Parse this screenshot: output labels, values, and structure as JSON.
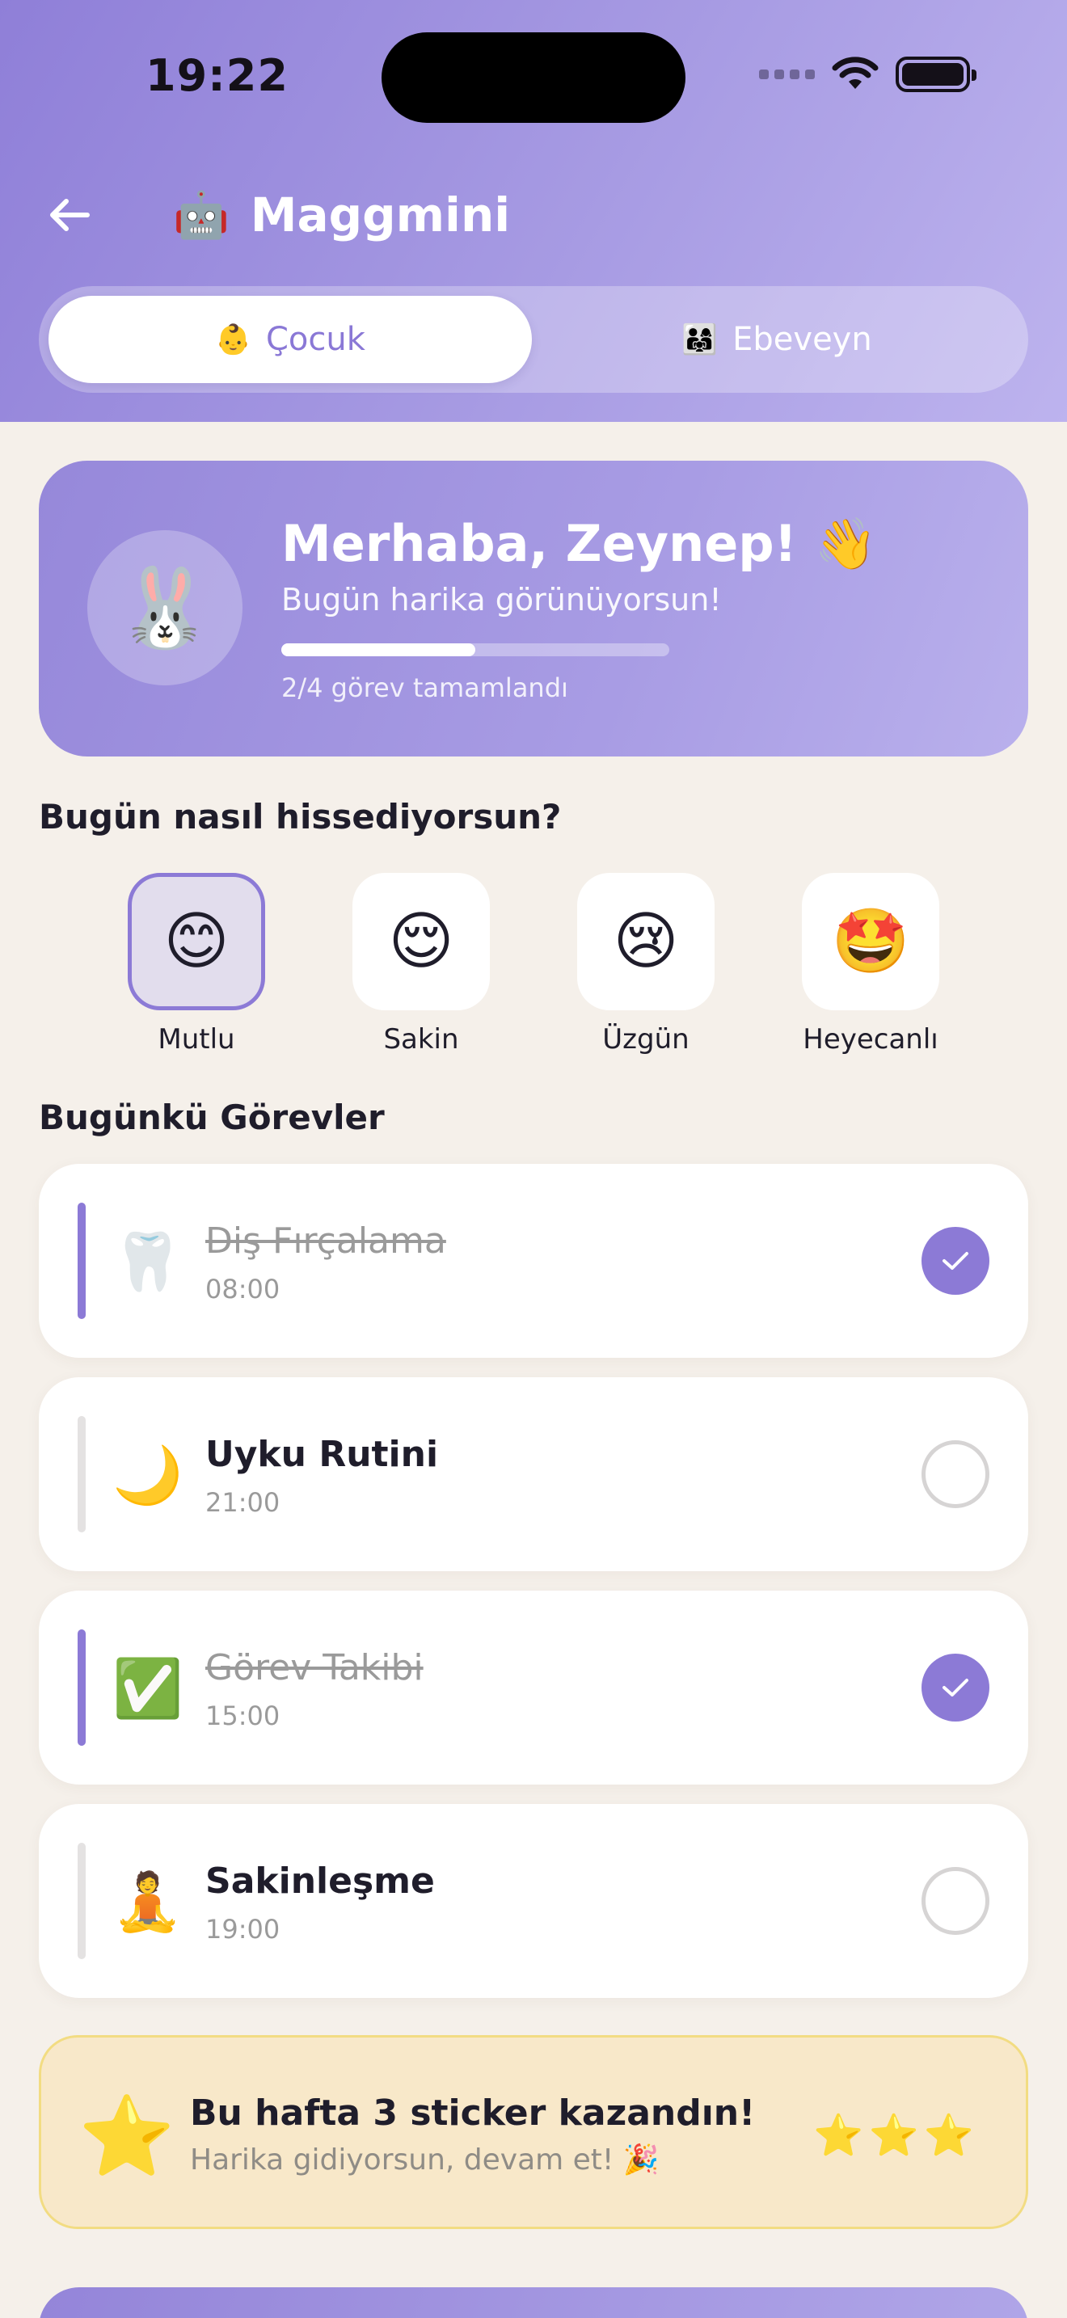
{
  "status_bar": {
    "time": "19:22"
  },
  "header": {
    "app_emoji": "🤖",
    "app_title": "Maggmini",
    "tabs": [
      {
        "emoji": "👶",
        "label": "Çocuk",
        "active": true
      },
      {
        "emoji": "👨‍👩‍👧",
        "label": "Ebeveyn",
        "active": false
      }
    ]
  },
  "greeting": {
    "avatar_emoji": "🐰",
    "title": "Merhaba, Zeynep! 👋",
    "subtitle": "Bugün harika görünüyorsun!",
    "progress_fraction": 0.5,
    "progress_text": "2/4 görev tamamlandı"
  },
  "mood_section": {
    "title": "Bugün nasıl hissediyorsun?",
    "moods": [
      {
        "emoji": "😊",
        "label": "Mutlu",
        "selected": true
      },
      {
        "emoji": "😌",
        "label": "Sakin",
        "selected": false
      },
      {
        "emoji": "😢",
        "label": "Üzgün",
        "selected": false
      },
      {
        "emoji": "🤩",
        "label": "Heyecanlı",
        "selected": false
      }
    ]
  },
  "tasks_section": {
    "title": "Bugünkü Görevler",
    "tasks": [
      {
        "emoji": "🦷",
        "name": "Diş Fırçalama",
        "time": "08:00",
        "done": true
      },
      {
        "emoji": "🌙",
        "name": "Uyku Rutini",
        "time": "21:00",
        "done": false
      },
      {
        "emoji": "✅",
        "name": "Görev Takibi",
        "time": "15:00",
        "done": true
      },
      {
        "emoji": "🧘",
        "name": "Sakinleşme",
        "time": "19:00",
        "done": false
      }
    ]
  },
  "sticker_banner": {
    "icon_emoji": "⭐",
    "title": "Bu hafta 3 sticker kazandın!",
    "subtitle": "Harika gidiyorsun, devam et! 🎉",
    "stars": "⭐⭐⭐"
  },
  "colors": {
    "accent": "#8c7ad6",
    "header_gradient_start": "#8f7fd8",
    "header_gradient_end": "#bdb3ee",
    "background": "#f5f0ea",
    "sticker_bg": "#f8e8c9"
  }
}
